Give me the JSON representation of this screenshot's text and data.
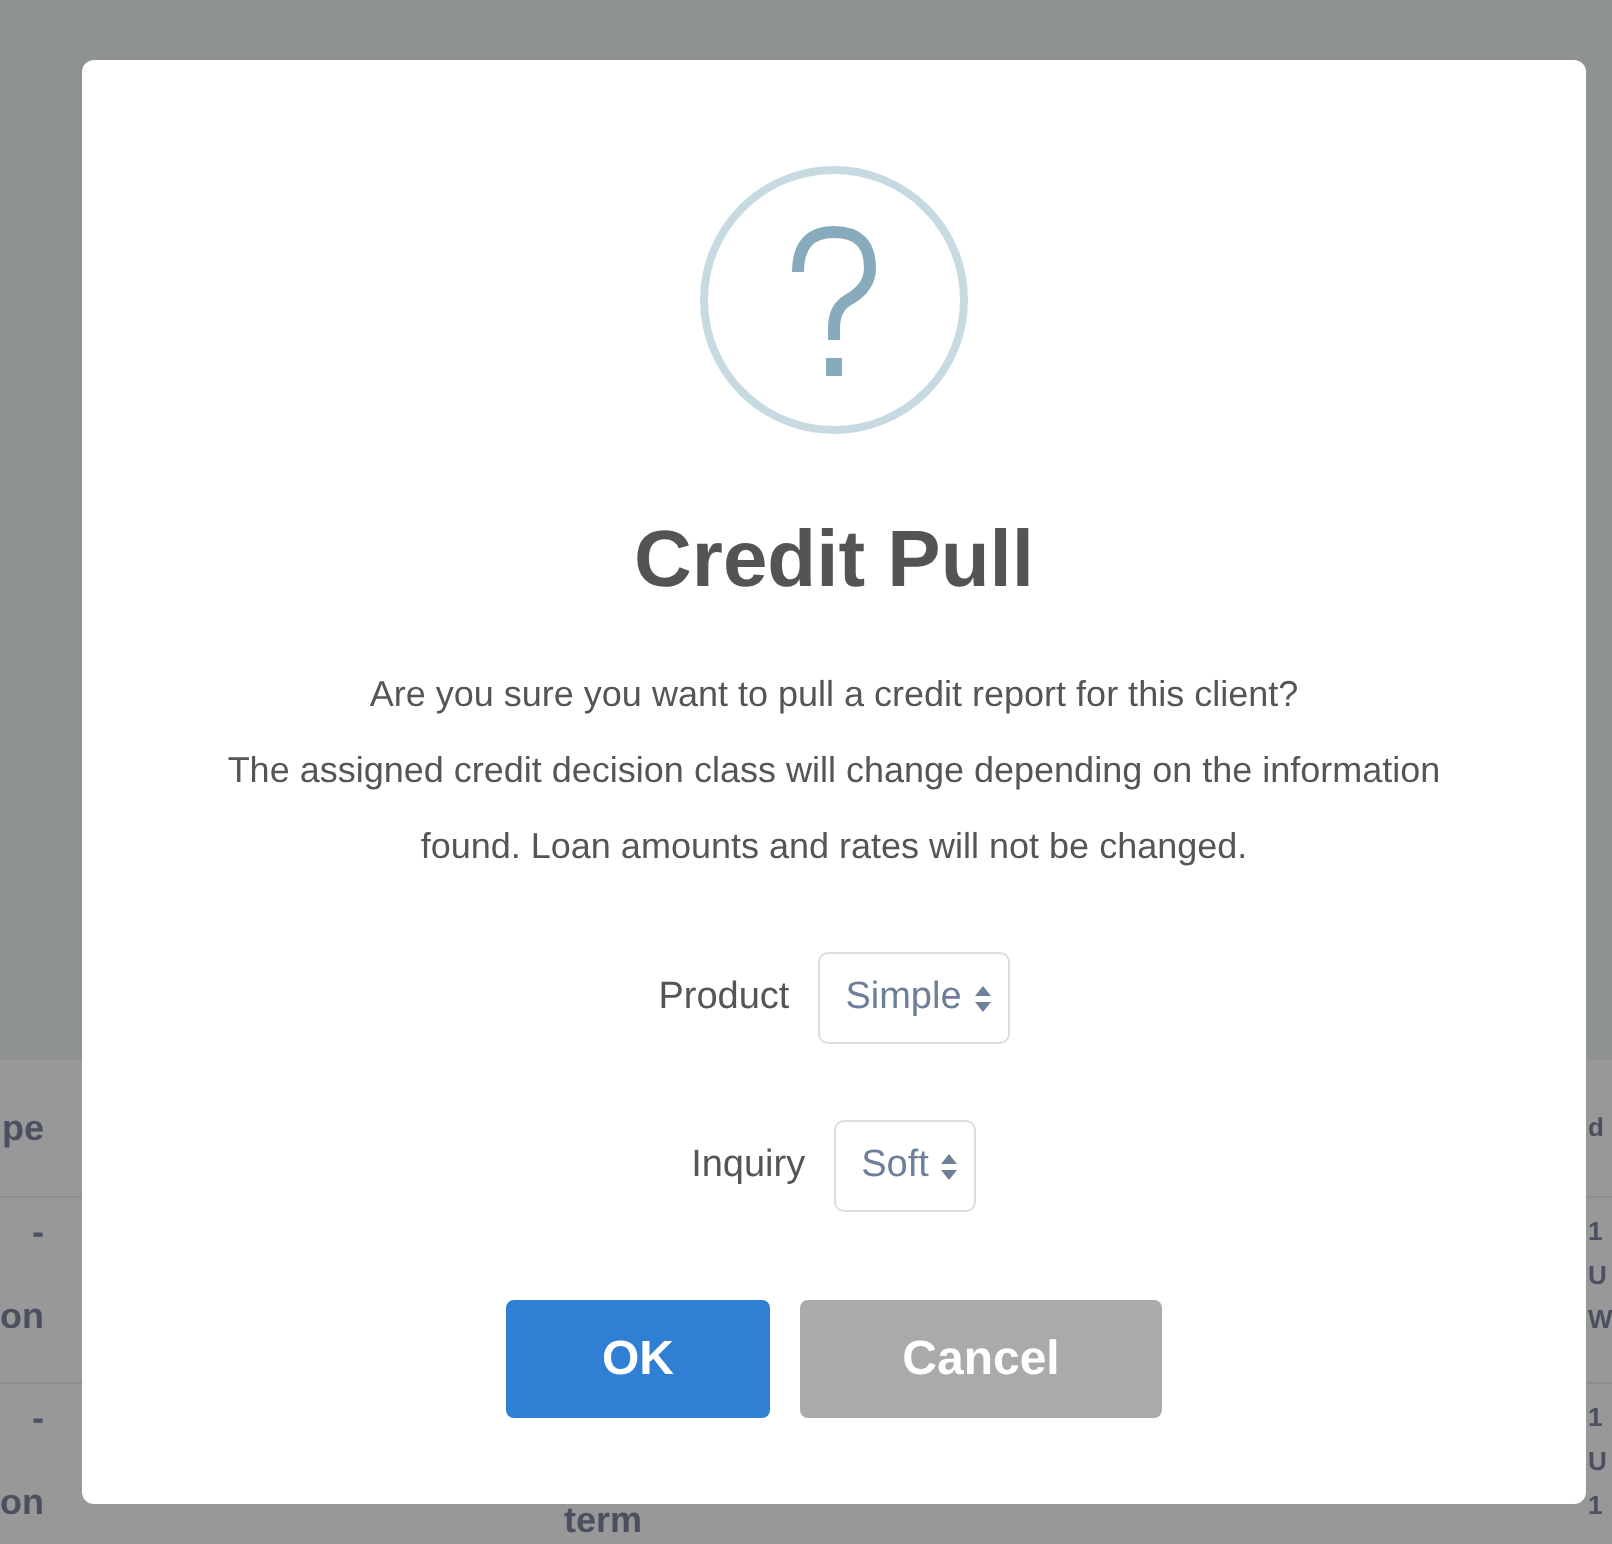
{
  "background_table": {
    "header": {
      "column_1": "pe",
      "column_3": "d"
    },
    "rows": [
      {
        "column_1": [
          "-",
          "on"
        ],
        "column_3": [
          "1",
          "U",
          "W"
        ]
      },
      {
        "column_1": [
          "-",
          "on"
        ],
        "column_2": "term",
        "column_3": [
          "1",
          "U",
          "1"
        ]
      }
    ]
  },
  "dialog": {
    "title": "Credit Pull",
    "message": [
      "Are you sure you want to pull a credit report for this client?",
      "The assigned credit decision class will change depending on the information found. Loan amounts and rates will not be changed."
    ],
    "fields": [
      {
        "label": "Product",
        "value": "Simple"
      },
      {
        "label": "Inquiry",
        "value": "Soft"
      }
    ],
    "buttons": [
      {
        "label": "OK",
        "kind": "primary"
      },
      {
        "label": "Cancel",
        "kind": "secondary"
      }
    ]
  }
}
